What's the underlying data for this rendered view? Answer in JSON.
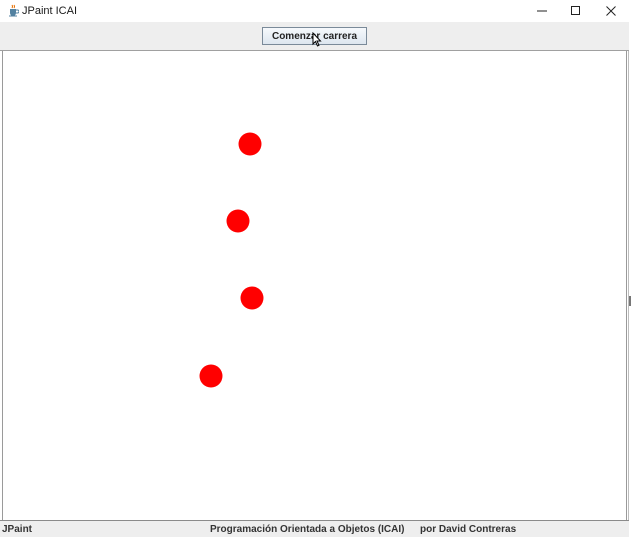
{
  "window": {
    "title": "JPaint ICAI"
  },
  "toolbar": {
    "start_label": "Comenzar carrera"
  },
  "canvas": {
    "ball_color": "#ff0000",
    "balls": [
      {
        "id": "runner-1"
      },
      {
        "id": "runner-2"
      },
      {
        "id": "runner-3"
      },
      {
        "id": "runner-4"
      }
    ]
  },
  "statusbar": {
    "left": "JPaint",
    "center": "Programación Orientada a Objetos (ICAI)",
    "right": "por David Contreras"
  },
  "icons": {
    "app": "java-cup-icon",
    "minimize": "minimize-icon",
    "maximize": "maximize-icon",
    "close": "close-icon",
    "pointer": "mouse-cursor-icon"
  }
}
